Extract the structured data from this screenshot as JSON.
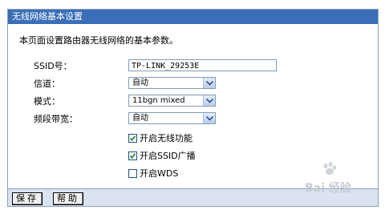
{
  "window": {
    "title": "无线网络基本设置"
  },
  "intro": "本页面设置路由器无线网络的基本参数。",
  "fields": {
    "ssid": {
      "label": "SSID号：",
      "value": "TP-LINK_29253E"
    },
    "channel": {
      "label": "信道：",
      "value": "自动"
    },
    "mode": {
      "label": "模式：",
      "value": "11bgn mixed"
    },
    "bandwidth": {
      "label": "频段带宽：",
      "value": "自动"
    }
  },
  "options": {
    "wireless": {
      "label": "开启无线功能",
      "checked": true
    },
    "ssid_broadcast": {
      "label": "开启SSID广播",
      "checked": true
    },
    "wds": {
      "label": "开启WDS",
      "checked": false
    }
  },
  "buttons": {
    "save": "保存",
    "help": "帮助"
  },
  "watermark": "Bai 经验",
  "colors": {
    "title_bar": "#3a6fb7",
    "footer": "#d9e3f1",
    "border": "#8aa0c4"
  }
}
